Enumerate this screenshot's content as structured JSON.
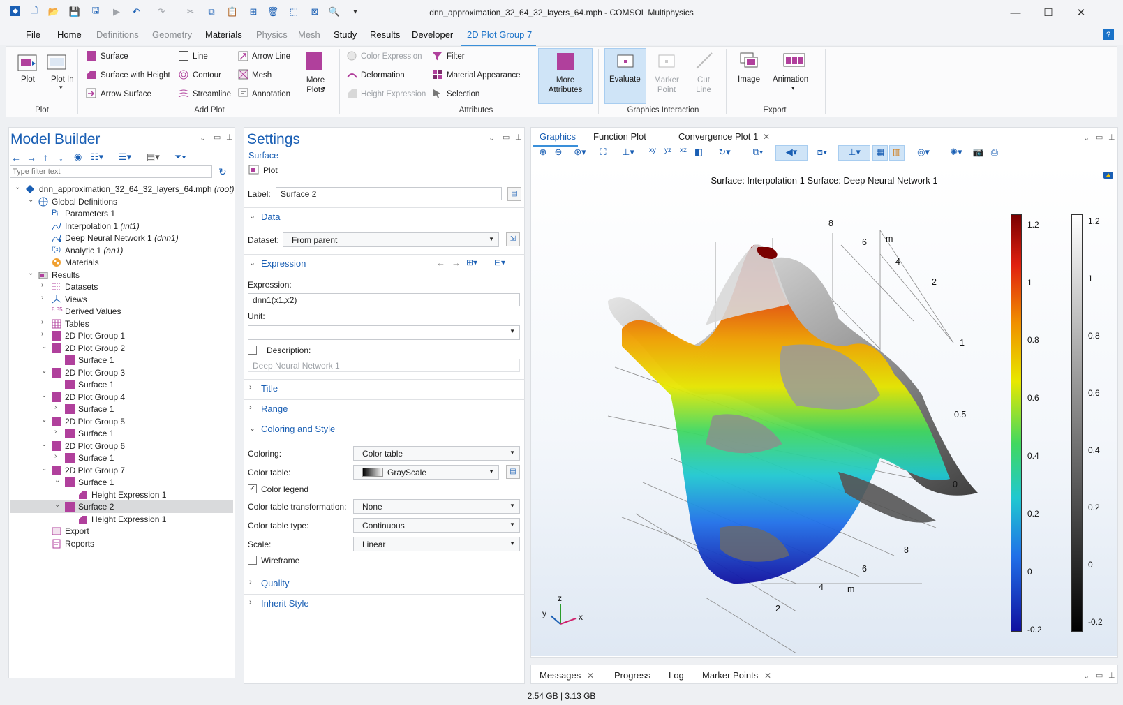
{
  "window": {
    "title": "dnn_approximation_32_64_32_layers_64.mph - COMSOL Multiphysics"
  },
  "menu": {
    "tabs": [
      "File",
      "Home",
      "Definitions",
      "Geometry",
      "Materials",
      "Physics",
      "Mesh",
      "Study",
      "Results",
      "Developer"
    ],
    "context_tab": "2D Plot Group 7",
    "help": "?"
  },
  "ribbon": {
    "plot_group": {
      "label": "Plot",
      "plot": "Plot",
      "plot_in": "Plot In"
    },
    "add_plot": {
      "label": "Add Plot",
      "surface": "Surface",
      "surface_height": "Surface with Height",
      "arrow_surface": "Arrow Surface",
      "line": "Line",
      "contour": "Contour",
      "streamline": "Streamline",
      "arrow_line": "Arrow Line",
      "mesh": "Mesh",
      "annotation": "Annotation",
      "more_plots": "More Plots"
    },
    "attributes": {
      "label": "Attributes",
      "color_expression": "Color Expression",
      "deformation": "Deformation",
      "height_expression": "Height Expression",
      "filter": "Filter",
      "material_appearance": "Material Appearance",
      "selection": "Selection",
      "more_attributes": "More Attributes"
    },
    "graphics_interaction": {
      "label": "Graphics Interaction",
      "evaluate": "Evaluate",
      "marker_point": "Marker Point",
      "cut_line": "Cut Line"
    },
    "export": {
      "label": "Export",
      "image": "Image",
      "animation": "Animation"
    }
  },
  "model_builder": {
    "title": "Model Builder",
    "filter_placeholder": "Type filter text",
    "tree": [
      {
        "label": "dnn_approximation_32_64_32_layers_64.mph",
        "suffix": "(root)"
      },
      {
        "label": "Global Definitions"
      },
      {
        "label": "Parameters 1"
      },
      {
        "label": "Interpolation 1",
        "suffix": "(int1)"
      },
      {
        "label": "Deep Neural Network 1",
        "suffix": "(dnn1)"
      },
      {
        "label": "Analytic 1",
        "suffix": "(an1)"
      },
      {
        "label": "Materials"
      },
      {
        "label": "Results"
      },
      {
        "label": "Datasets"
      },
      {
        "label": "Views"
      },
      {
        "label": "Derived Values"
      },
      {
        "label": "Tables"
      },
      {
        "label": "2D Plot Group 1"
      },
      {
        "label": "2D Plot Group 2"
      },
      {
        "label": "Surface 1"
      },
      {
        "label": "2D Plot Group 3"
      },
      {
        "label": "Surface 1"
      },
      {
        "label": "2D Plot Group 4"
      },
      {
        "label": "Surface 1"
      },
      {
        "label": "2D Plot Group 5"
      },
      {
        "label": "Surface 1"
      },
      {
        "label": "2D Plot Group 6"
      },
      {
        "label": "Surface 1"
      },
      {
        "label": "2D Plot Group 7"
      },
      {
        "label": "Surface 1"
      },
      {
        "label": "Height Expression 1"
      },
      {
        "label": "Surface 2"
      },
      {
        "label": "Height Expression 1"
      },
      {
        "label": "Export"
      },
      {
        "label": "Reports"
      }
    ]
  },
  "settings": {
    "title": "Settings",
    "subtitle": "Surface",
    "plot_button": "Plot",
    "label_field": {
      "label": "Label:",
      "value": "Surface 2"
    },
    "data": {
      "header": "Data",
      "dataset_label": "Dataset:",
      "dataset_value": "From parent"
    },
    "expression": {
      "header": "Expression",
      "expression_label": "Expression:",
      "expression_value": "dnn1(x1,x2)",
      "unit_label": "Unit:",
      "unit_value": "",
      "description_label": "Description:",
      "description_value": "Deep Neural Network 1"
    },
    "title_section": "Title",
    "range_section": "Range",
    "coloring": {
      "header": "Coloring and Style",
      "coloring_label": "Coloring:",
      "coloring_value": "Color table",
      "color_table_label": "Color table:",
      "color_table_value": "GrayScale",
      "color_legend_label": "Color legend",
      "transformation_label": "Color table transformation:",
      "transformation_value": "None",
      "type_label": "Color table type:",
      "type_value": "Continuous",
      "scale_label": "Scale:",
      "scale_value": "Linear",
      "wireframe_label": "Wireframe"
    },
    "quality_section": "Quality",
    "inherit_section": "Inherit Style"
  },
  "graphics": {
    "tabs": [
      "Graphics",
      "Function Plot",
      "Convergence Plot 1"
    ],
    "plot_title": "Surface: Interpolation 1  Surface: Deep Neural Network 1",
    "axis_ticks_back": [
      "8",
      "6",
      "4",
      "2"
    ],
    "axis_ticks_right": [
      "1",
      "0.5",
      "0"
    ],
    "axis_ticks_front": [
      "8",
      "6",
      "4",
      "2"
    ],
    "unit_m": "m",
    "triad": {
      "x": "x",
      "y": "y",
      "z": "z"
    },
    "colorbar_rainbow": [
      "1.2",
      "1",
      "0.8",
      "0.6",
      "0.4",
      "0.2",
      "0",
      "-0.2"
    ],
    "colorbar_gray": [
      "1.2",
      "1",
      "0.8",
      "0.6",
      "0.4",
      "0.2",
      "0",
      "-0.2"
    ]
  },
  "bottom": {
    "tabs": [
      "Messages",
      "Progress",
      "Log",
      "Marker Points"
    ],
    "status": "2.54 GB | 3.13 GB"
  }
}
